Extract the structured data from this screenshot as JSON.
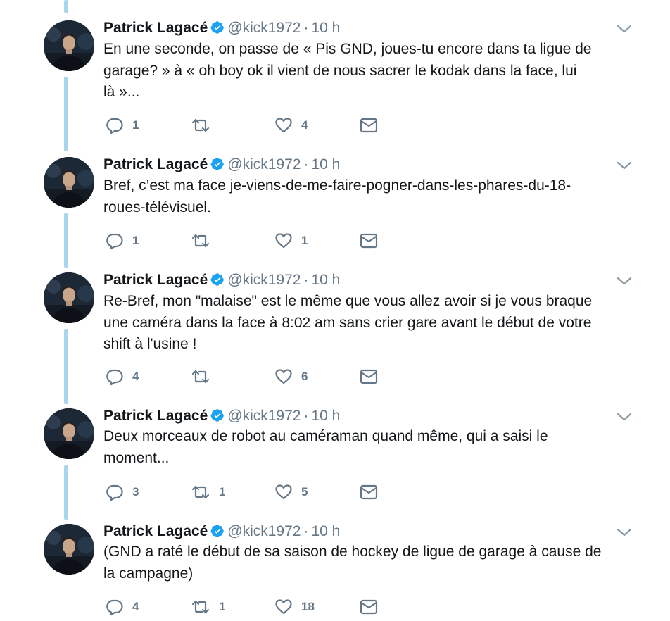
{
  "tweets": [
    {
      "name": "Patrick Lagacé",
      "handle": "@kick1972",
      "time": "10 h",
      "text": "En une seconde, on passe de « Pis GND, joues-tu encore dans ta ligue de\ngarage? » à « oh boy ok il vient de nous sacrer le kodak dans la face, lui\nlà »...",
      "replies": "1",
      "retweets": "",
      "likes": "4"
    },
    {
      "name": "Patrick Lagacé",
      "handle": "@kick1972",
      "time": "10 h",
      "text": "Bref, c’est ma face je-viens-de-me-faire-pogner-dans-les-phares-du-18-\nroues-télévisuel.",
      "replies": "1",
      "retweets": "",
      "likes": "1"
    },
    {
      "name": "Patrick Lagacé",
      "handle": "@kick1972",
      "time": "10 h",
      "text": "Re-Bref, mon \"malaise\" est le même que vous allez avoir si je vous braque\nune caméra dans la face à 8:02 am sans crier gare avant le début de votre\nshift à l'usine !",
      "replies": "4",
      "retweets": "",
      "likes": "6"
    },
    {
      "name": "Patrick Lagacé",
      "handle": "@kick1972",
      "time": "10 h",
      "text": "Deux morceaux de robot au caméraman quand même, qui a saisi le\nmoment...",
      "replies": "3",
      "retweets": "1",
      "likes": "5"
    },
    {
      "name": "Patrick Lagacé",
      "handle": "@kick1972",
      "time": "10 h",
      "text": "(GND a raté le début de sa saison de hockey de ligue de garage à cause de\nla campagne)",
      "replies": "4",
      "retweets": "1",
      "likes": "18"
    }
  ],
  "colors": {
    "thread_line": "#a9d5ef",
    "verified": "#1da1f2",
    "muted": "#657786",
    "text": "#14171a"
  },
  "icons": {
    "reply": "reply-icon",
    "retweet": "retweet-icon",
    "like": "heart-icon",
    "dm": "envelope-icon",
    "verified": "verified-badge-icon",
    "menu": "chevron-down-icon"
  }
}
